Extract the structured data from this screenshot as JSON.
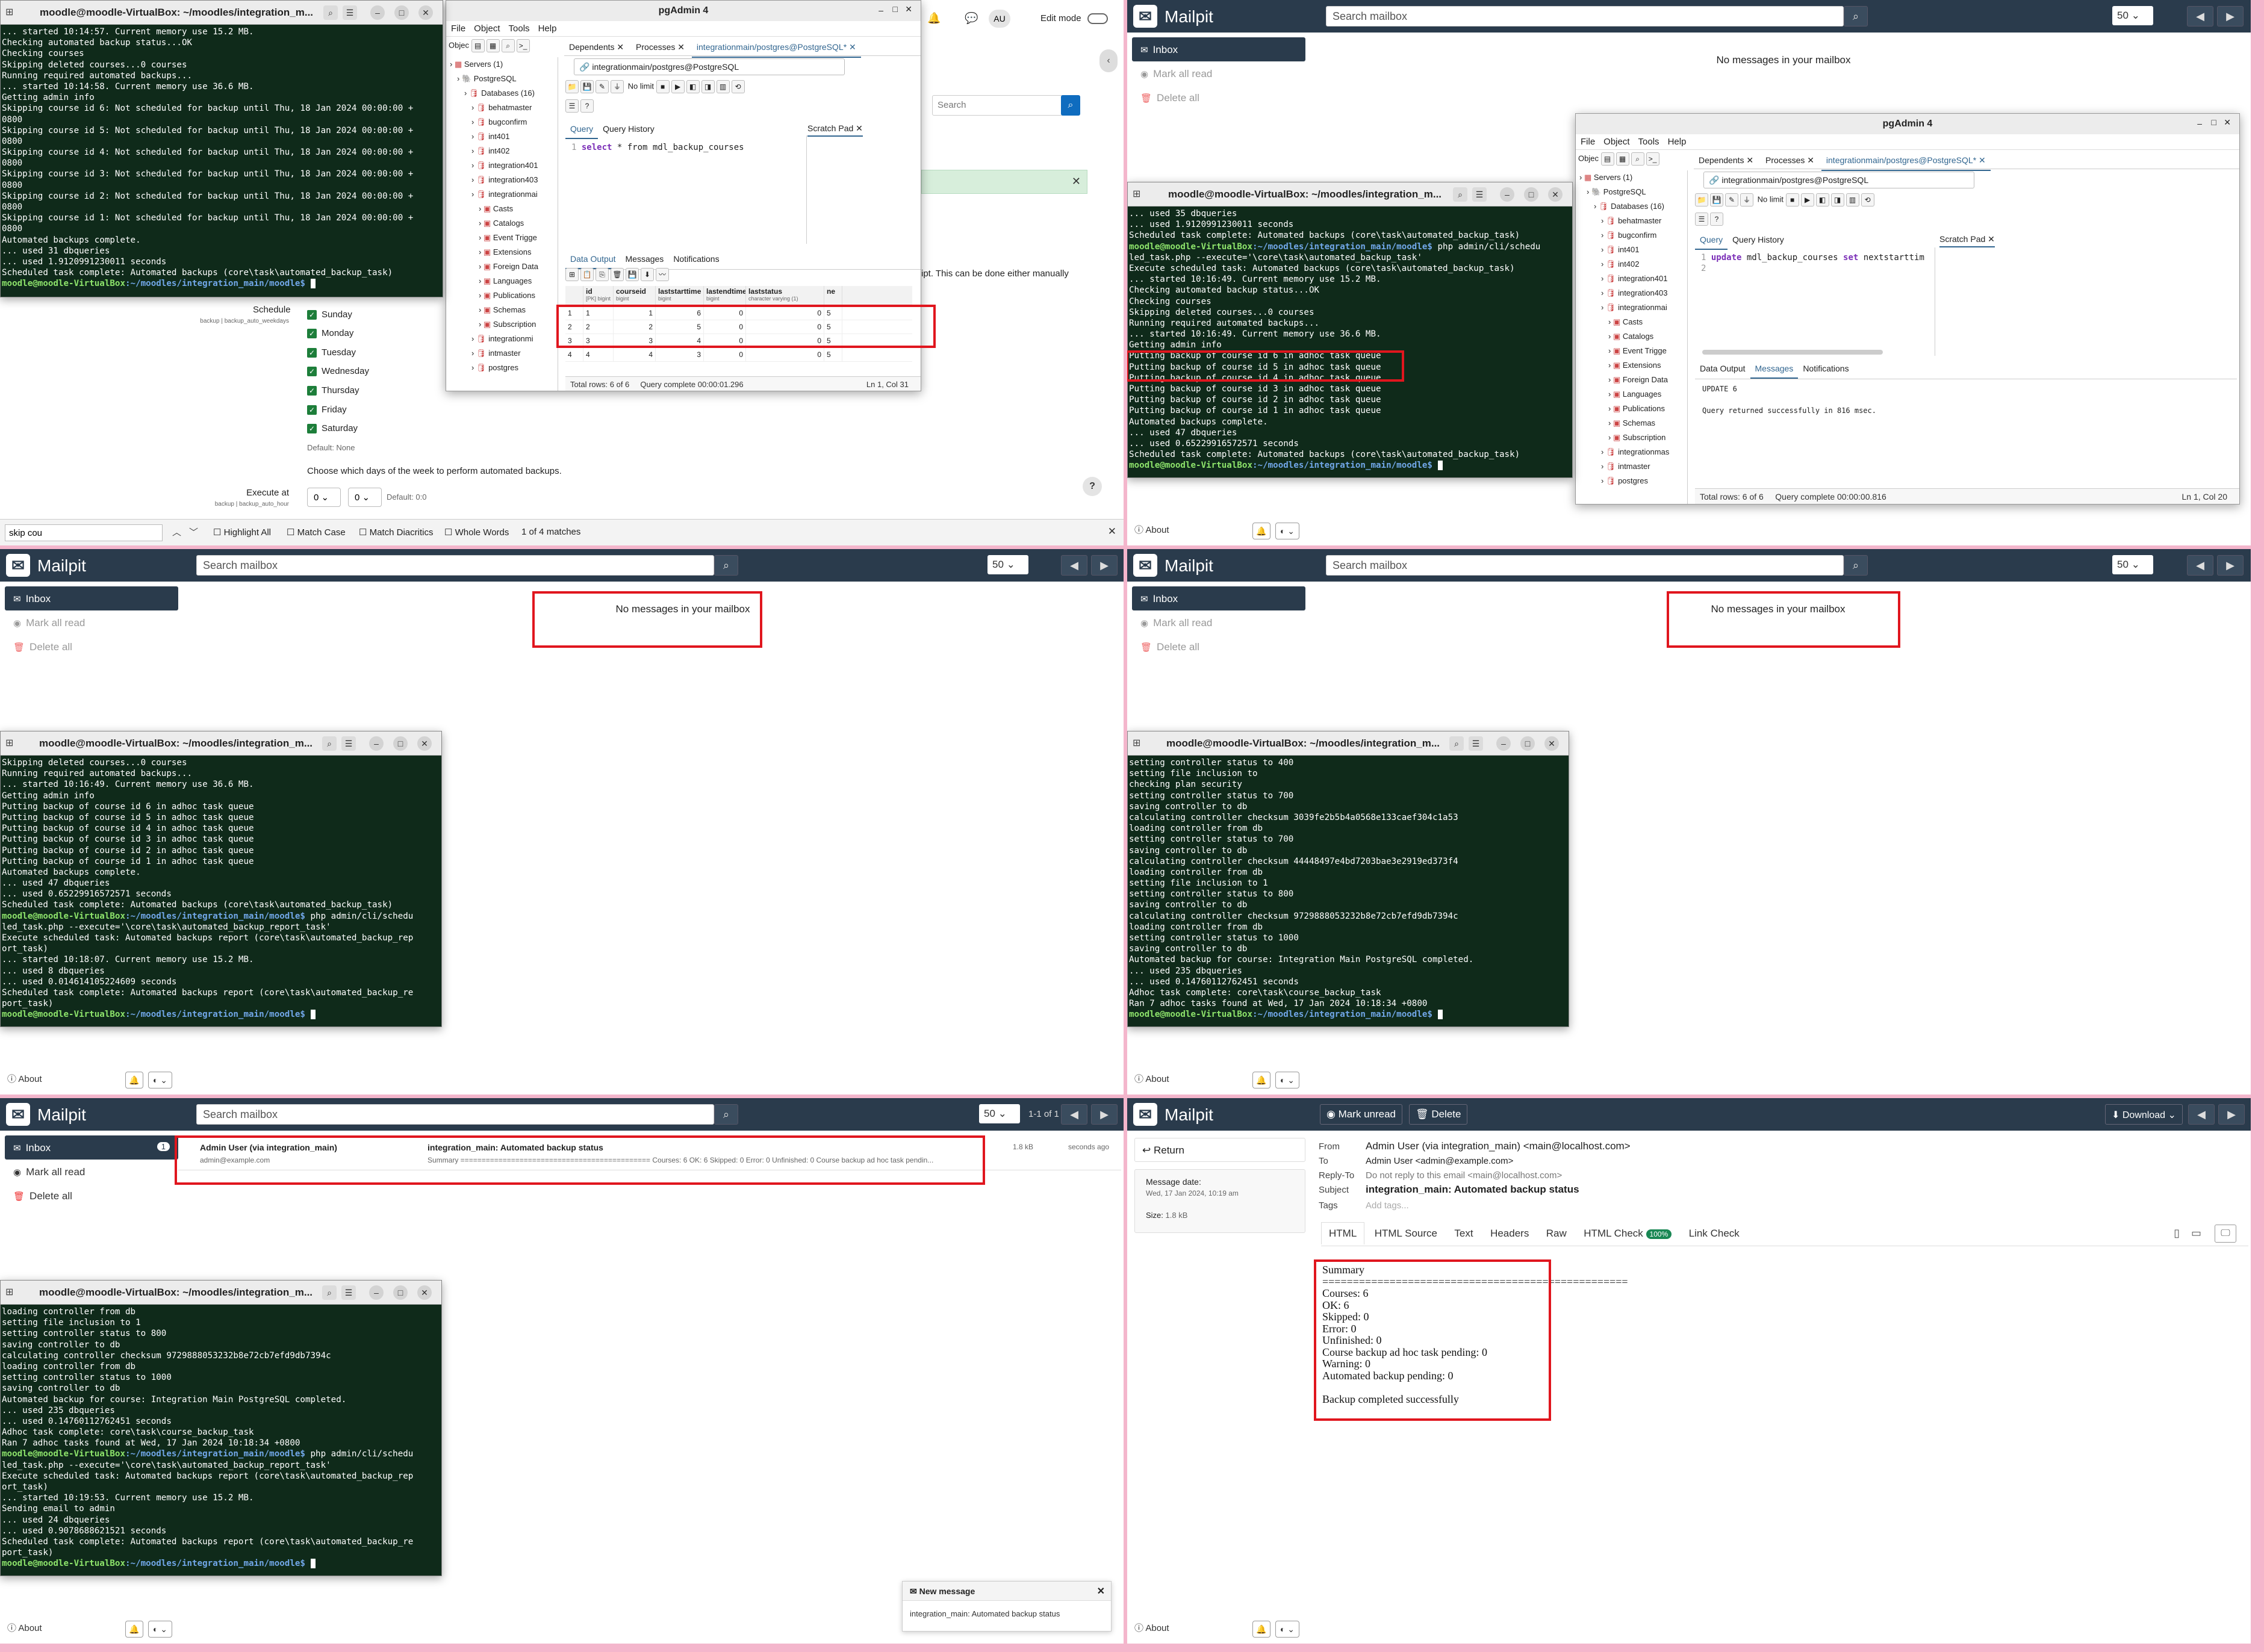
{
  "mailpit": {
    "brand": "Mailpit",
    "search_placeholder": "Search mailbox",
    "per_page": "50",
    "inbox": "Inbox",
    "mark_all_read": "Mark all read",
    "delete_all": "Delete all",
    "empty": "No messages in your mailbox",
    "about": "About",
    "inbox_count": "1",
    "pagination": "1-1 of 1"
  },
  "p1": {
    "term_title": "moodle@moodle-VirtualBox: ~/moodles/integration_m...",
    "term_lines": [
      "... started 10:14:57. Current memory use 15.2 MB.",
      "Checking automated backup status...OK",
      "Checking courses",
      "Skipping deleted courses...0 courses",
      "Running required automated backups...",
      "... started 10:14:58. Current memory use 36.6 MB.",
      "Getting admin info",
      "Skipping course id 6: Not scheduled for backup until Thu, 18 Jan 2024 00:00:00 +",
      "0800",
      "Skipping course id 5: Not scheduled for backup until Thu, 18 Jan 2024 00:00:00 +",
      "0800",
      "Skipping course id 4: Not scheduled for backup until Thu, 18 Jan 2024 00:00:00 +",
      "0800",
      "Skipping course id 3: Not scheduled for backup until Thu, 18 Jan 2024 00:00:00 +",
      "0800",
      "Skipping course id 2: Not scheduled for backup until Thu, 18 Jan 2024 00:00:00 +",
      "0800",
      "Skipping course id 1: Not scheduled for backup until Thu, 18 Jan 2024 00:00:00 +",
      "0800",
      "Automated backups complete.",
      "... used 31 dbqueries",
      "... used 1.9120991230011 seconds",
      "Scheduled task complete: Automated backups (core\\task\\automated_backup_task)"
    ],
    "prompt_user": "moodle@moodle-VirtualBox",
    "prompt_path": ":~/moodles/integration_main/moodle$",
    "pga_title": "pgAdmin 4",
    "menu": [
      "File",
      "Object",
      "Tools",
      "Help"
    ],
    "tree": [
      "Servers (1)",
      "PostgreSQL",
      "Databases (16)",
      "behatmaster",
      "bugconfirm",
      "int401",
      "int402",
      "integration401",
      "integration403",
      "integrationmai",
      "Casts",
      "Catalogs",
      "Event Trigge",
      "Extensions",
      "Foreign Data",
      "Languages",
      "Publications",
      "Schemas",
      "Subscription",
      "integrationmi",
      "intmaster",
      "postgres"
    ],
    "tabs": [
      "Dependents",
      "Processes",
      "integrationmain/postgres@PostgreSQL*"
    ],
    "conn": "integrationmain/postgres@PostgreSQL",
    "no_limit": "No limit",
    "subtabs": [
      "Query",
      "Query History"
    ],
    "scratch": "Scratch Pad",
    "sql_kw": "select",
    "sql_rest": " * from mdl_backup_courses",
    "out_tabs": [
      "Data Output",
      "Messages",
      "Notifications"
    ],
    "cols": [
      "id",
      "courseid",
      "laststarttime",
      "lastendtime",
      "laststatus",
      "ne"
    ],
    "coltypes": [
      "[PK] bigint",
      "bigint",
      "bigint",
      "bigint",
      "character varying (1)",
      ""
    ],
    "rows": [
      [
        "1",
        "1",
        "1",
        "6",
        "0",
        "0",
        "5"
      ],
      [
        "2",
        "2",
        "2",
        "5",
        "0",
        "0",
        "5"
      ],
      [
        "3",
        "3",
        "3",
        "4",
        "0",
        "0",
        "5"
      ],
      [
        "4",
        "4",
        "4",
        "3",
        "0",
        "0",
        "5"
      ]
    ],
    "status": "Total rows: 6 of 6",
    "status2": "Query complete 00:00:01.296",
    "status3": "Ln 1, Col 31",
    "schedule_label": "Schedule",
    "schedule_sub": "backup | backup_auto_weekdays",
    "days": [
      "Sunday",
      "Monday",
      "Tuesday",
      "Wednesday",
      "Thursday",
      "Friday",
      "Saturday"
    ],
    "default_none": "Default: None",
    "choose": "Choose which days of the week to perform automated backups.",
    "execute_at": "Execute at",
    "execute_sub": "backup | backup_auto_hour",
    "h": "0",
    "m": "0",
    "default_time": "Default: 0:0",
    "right_text": "ipt. This can be done either manually",
    "search": "Search",
    "edit_mode": "Edit mode",
    "au": "AU",
    "find_value": "skip cou",
    "find_opts": [
      "Highlight All",
      "Match Case",
      "Match Diacritics",
      "Whole Words"
    ],
    "find_count": "1 of 4 matches"
  },
  "p2": {
    "term_title": "moodle@moodle-VirtualBox: ~/moodles/integration_m...",
    "term_lines": [
      "... used 35 dbqueries",
      "... used 1.9120991230011 seconds",
      "Scheduled task complete: Automated backups (core\\task\\automated_backup_task)",
      "@@php admin/cli/schedu",
      "led_task.php --execute='\\core\\task\\automated_backup_task'",
      "Execute scheduled task: Automated backups (core\\task\\automated_backup_task)",
      "... started 10:16:49. Current memory use 15.2 MB.",
      "Checking automated backup status...OK",
      "Checking courses",
      "Skipping deleted courses...0 courses",
      "Running required automated backups...",
      "... started 10:16:49. Current memory use 36.6 MB.",
      "Getting admin info",
      "Putting backup of course id 6 in adhoc task queue",
      "Putting backup of course id 5 in adhoc task queue",
      "Putting backup of course id 4 in adhoc task queue",
      "Putting backup of course id 3 in adhoc task queue",
      "Putting backup of course id 2 in adhoc task queue",
      "Putting backup of course id 1 in adhoc task queue",
      "Automated backups complete.",
      "... used 47 dbqueries",
      "... used 0.65229916572571 seconds",
      "Scheduled task complete: Automated backups (core\\task\\automated_backup_task)",
      "@@"
    ],
    "pga_title": "pgAdmin 4",
    "tree": [
      "Servers (1)",
      "PostgreSQL",
      "Databases (16)",
      "behatmaster",
      "bugconfirm",
      "int401",
      "int402",
      "integration401",
      "integration403",
      "integrationmai",
      "Casts",
      "Catalogs",
      "Event Trigge",
      "Extensions",
      "Foreign Data",
      "Languages",
      "Publications",
      "Schemas",
      "Subscription",
      "integrationmas",
      "intmaster",
      "postgres"
    ],
    "sql_kw": "update",
    "sql_rest": " mdl_backup_courses ",
    "sql_kw2": "set",
    "sql_rest2": " nextstarttim",
    "msg1": "UPDATE 6",
    "msg2": "Query returned successfully in 816 msec.",
    "status2": "Query complete 00:00:00.816",
    "status3": "Ln 1, Col 20"
  },
  "p3": {
    "term_lines": [
      "Skipping deleted courses...0 courses",
      "Running required automated backups...",
      "... started 10:16:49. Current memory use 36.6 MB.",
      "Getting admin info",
      "Putting backup of course id 6 in adhoc task queue",
      "Putting backup of course id 5 in adhoc task queue",
      "Putting backup of course id 4 in adhoc task queue",
      "Putting backup of course id 3 in adhoc task queue",
      "Putting backup of course id 2 in adhoc task queue",
      "Putting backup of course id 1 in adhoc task queue",
      "Automated backups complete.",
      "... used 47 dbqueries",
      "... used 0.65229916572571 seconds",
      "Scheduled task complete: Automated backups (core\\task\\automated_backup_task)",
      "@@php admin/cli/schedu",
      "led_task.php --execute='\\core\\task\\automated_backup_report_task'",
      "Execute scheduled task: Automated backups report (core\\task\\automated_backup_rep",
      "ort_task)",
      "... started 10:18:07. Current memory use 15.2 MB.",
      "... used 8 dbqueries",
      "... used 0.014614105224609 seconds",
      "Scheduled task complete: Automated backups report (core\\task\\automated_backup_re",
      "port_task)",
      "@@"
    ]
  },
  "p4": {
    "term_lines": [
      "setting controller status to 400",
      "setting file inclusion to",
      "checking plan security",
      "setting controller status to 700",
      "saving controller to db",
      "calculating controller checksum 3039fe2b5b4a0568e133caef304c1a53",
      "loading controller from db",
      "setting controller status to 700",
      "saving controller to db",
      "calculating controller checksum 44448497e4bd7203bae3e2919ed373f4",
      "loading controller from db",
      "setting file inclusion to 1",
      "setting controller status to 800",
      "saving controller to db",
      "calculating controller checksum 9729888053232b8e72cb7efd9db7394c",
      "loading controller from db",
      "setting controller status to 1000",
      "saving controller to db",
      "Automated backup for course: Integration Main PostgreSQL completed.",
      "... used 235 dbqueries",
      "... used 0.14760112762451 seconds",
      "Adhoc task complete: core\\task\\course_backup_task",
      "Ran 7 adhoc tasks found at Wed, 17 Jan 2024 10:18:34 +0800",
      "@@"
    ]
  },
  "p5": {
    "from_name": "Admin User (via integration_main)",
    "from_email": "admin@example.com",
    "subject": "integration_main: Automated backup status",
    "preview": "Summary ============================================= Courses: 6 OK: 6 Skipped: 0 Error: 0 Unfinished: 0 Course backup ad hoc task pendin...",
    "size": "1.8 kB",
    "age": "seconds ago",
    "term_lines": [
      "loading controller from db",
      "setting file inclusion to 1",
      "setting controller status to 800",
      "saving controller to db",
      "calculating controller checksum 9729888053232b8e72cb7efd9db7394c",
      "loading controller from db",
      "setting controller status to 1000",
      "saving controller to db",
      "Automated backup for course: Integration Main PostgreSQL completed.",
      "... used 235 dbqueries",
      "... used 0.14760112762451 seconds",
      "Adhoc task complete: core\\task\\course_backup_task",
      "Ran 7 adhoc tasks found at Wed, 17 Jan 2024 10:18:34 +0800",
      "@@php admin/cli/schedu",
      "led_task.php --execute='\\core\\task\\automated_backup_report_task'",
      "Execute scheduled task: Automated backups report (core\\task\\automated_backup_rep",
      "ort_task)",
      "... started 10:19:53. Current memory use 15.2 MB.",
      "Sending email to admin",
      "... used 24 dbqueries",
      "... used 0.9078688621521 seconds",
      "Scheduled task complete: Automated backups report (core\\task\\automated_backup_re",
      "port_task)",
      "@@"
    ],
    "toast_title": "New message",
    "toast_body": "integration_main: Automated backup status"
  },
  "p6": {
    "mark_unread": "Mark unread",
    "delete": "Delete",
    "download": "Download",
    "return": "Return",
    "msg_date_lbl": "Message date:",
    "msg_date": "Wed, 17 Jan 2024, 10:19 am",
    "size_lbl": "Size:",
    "size": "1.8 kB",
    "from_lbl": "From",
    "from": "Admin User (via integration_main) <main@localhost.com>",
    "to_lbl": "To",
    "to": "Admin User <admin@example.com>",
    "reply_lbl": "Reply-To",
    "reply": "Do not reply to this email <main@localhost.com>",
    "subject_lbl": "Subject",
    "subject": "integration_main: Automated backup status",
    "tags_lbl": "Tags",
    "tags": "Add tags...",
    "tabs": [
      "HTML",
      "HTML Source",
      "Text",
      "Headers",
      "Raw",
      "HTML Check",
      "Link Check"
    ],
    "check_badge": "100%",
    "body": [
      "Summary",
      "==================================================",
      "Courses: 6",
      "OK: 6",
      "Skipped: 0",
      "Error: 0",
      "Unfinished: 0",
      "Course backup ad hoc task pending: 0",
      "Warning: 0",
      "Automated backup pending: 0",
      "",
      "Backup completed successfully"
    ]
  }
}
